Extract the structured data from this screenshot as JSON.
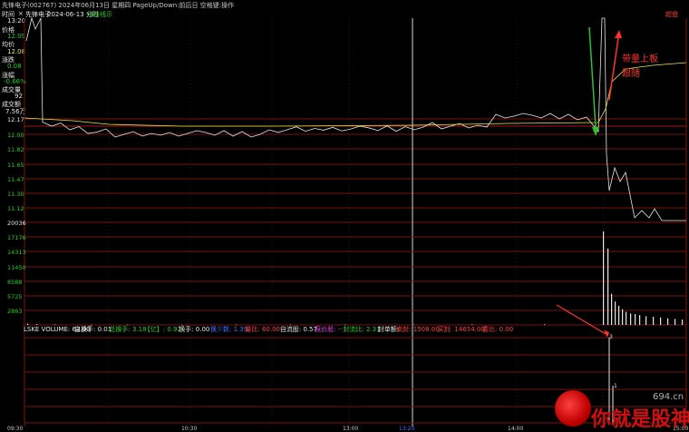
{
  "title_bar": {
    "text": "先锋电子(002767) 2024年06月13日 星期四 PageUp/Down:前后日 空格键:操作"
  },
  "tab_bar": {
    "time_tab": "时间",
    "close": "×",
    "stock_label": "先锋电子",
    "date_label": "2024-06-13 分时",
    "mode_label": "均价线示"
  },
  "top_right": {
    "button": "超盘"
  },
  "info_panel": {
    "time": "13:20",
    "price_label": "价格",
    "price_value": "12.09",
    "avg_label": "均价",
    "avg_value": "12.08",
    "change_label": "涨跌",
    "change_value": "0.08",
    "pct_label": "涨幅",
    "pct_value": "-0.66%",
    "vol_label": "成交量",
    "vol_value": "92",
    "amt_label": "成交额",
    "amt_value": "7.56万"
  },
  "price_axis": [
    "12.17",
    "12.00",
    "11.82",
    "11.65",
    "11.47",
    "11.30",
    "11.12",
    "20036"
  ],
  "volume_axis": [
    "17176",
    "14313",
    "11450",
    "8588",
    "5725",
    "2863"
  ],
  "indicator_bar": {
    "name": "LSKE VOLUME: 62.00",
    "items": [
      {
        "text": "自换手: 0.01",
        "color": "#e6e6e6"
      },
      {
        "text": "总换手: 3.18",
        "color": "#22d022"
      },
      {
        "text": "【亿】: 0.92",
        "color": "#22d022"
      },
      {
        "text": "换手: 0.00",
        "color": "#e6e6e6"
      },
      {
        "text": "换少数: 1.39",
        "color": "#4070ff"
      },
      {
        "text": "量比: 60.00",
        "color": "#ff4040"
      },
      {
        "text": "自流股: 0.57",
        "color": "#e6e6e6"
      },
      {
        "text": "竞价股: --",
        "color": "#e040e0"
      },
      {
        "text": "封流比: 2.31",
        "color": "#22d022"
      },
      {
        "text": "封单额:",
        "color": "#e6e6e6"
      },
      {
        "text": "卖封: 1508.00",
        "color": "#ff4040"
      },
      {
        "text": "买封: 14654.00",
        "color": "#ff4040"
      },
      {
        "text": "委比: 0.00",
        "color": "#ff4040"
      }
    ]
  },
  "annotations": {
    "note1": "带量上板",
    "note2": "跟随",
    "lower_label_1": "3",
    "lower_label_2": "1"
  },
  "time_axis": [
    "09:30",
    "10:30",
    "13:00",
    "13:20",
    "14:00",
    "15:00"
  ],
  "watermark": {
    "site": "694.cn",
    "text": "你就是股神"
  },
  "colors": {
    "grid_red": "#7a1010",
    "price_line": "#e6e6e6",
    "avg_line": "#e8e840",
    "volume_bar": "#e6e6e6",
    "up": "#ff4040",
    "down": "#22d022"
  },
  "chart_data": {
    "type": "line",
    "title": "",
    "xlabel": "",
    "ylabel": "",
    "ylim": [
      11.12,
      12.17
    ],
    "series": [
      {
        "name": "价格",
        "values": [
          12.17,
          12.12,
          12.08,
          12.05,
          12.04,
          12.05,
          12.06,
          12.06,
          12.08,
          12.09,
          12.13,
          12.14,
          12.16,
          12.18,
          12.76,
          12.74,
          11.47,
          11.3,
          11.12
        ]
      },
      {
        "name": "均价",
        "values": [
          12.16,
          12.14,
          12.12,
          12.11,
          12.11,
          12.11,
          12.11,
          12.1,
          12.1,
          12.1,
          12.1,
          12.1,
          12.11,
          12.12,
          12.55,
          12.59,
          12.62,
          12.63,
          12.63
        ]
      }
    ],
    "volume": [
      200,
      150,
      120,
      100,
      90,
      95,
      110,
      120,
      150,
      180,
      300,
      17176,
      5725,
      4300,
      2863,
      2000,
      1500,
      1200,
      1000
    ]
  }
}
